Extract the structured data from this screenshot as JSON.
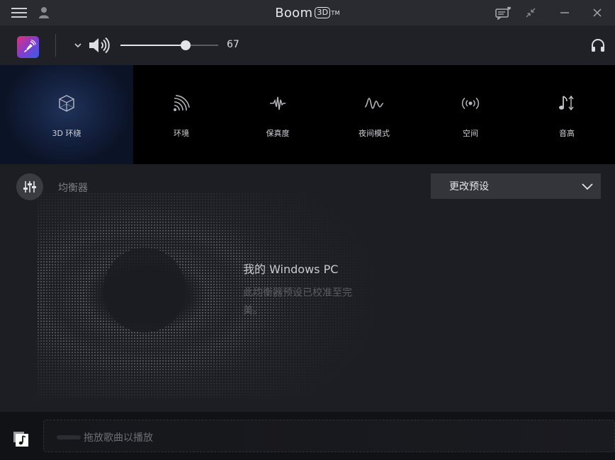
{
  "titlebar": {
    "title": "Boom",
    "title_badge": "3D",
    "title_tm": "TM",
    "icons": [
      "hamburger-menu-icon",
      "user-icon",
      "feedback-heart-icon",
      "collapse-icon",
      "minimize-icon",
      "close-icon"
    ]
  },
  "volume": {
    "value": "67",
    "level": 0.67,
    "icons": [
      "app-logo-icon",
      "chevron-down-icon",
      "speaker-icon",
      "headphones-icon"
    ]
  },
  "effects": [
    {
      "label": "3D 环绕",
      "icon": "cube-icon",
      "active": true
    },
    {
      "label": "环境",
      "icon": "ambience-waves-icon",
      "active": false
    },
    {
      "label": "保真度",
      "icon": "fidelity-wave-icon",
      "active": false
    },
    {
      "label": "夜间模式",
      "icon": "night-mode-wave-icon",
      "active": false
    },
    {
      "label": "空间",
      "icon": "spatial-icon",
      "active": false
    },
    {
      "label": "音高",
      "icon": "pitch-icon",
      "active": false
    }
  ],
  "equalizer": {
    "title": "均衡器",
    "preset_label": "更改预设",
    "message_title": "我的 Windows PC",
    "message_body": "此均衡器预设已校准至完美。"
  },
  "player": {
    "drop_text": "拖放歌曲以播放"
  },
  "colors": {
    "accent_active": "#13203e",
    "background": "#1b1c20"
  }
}
